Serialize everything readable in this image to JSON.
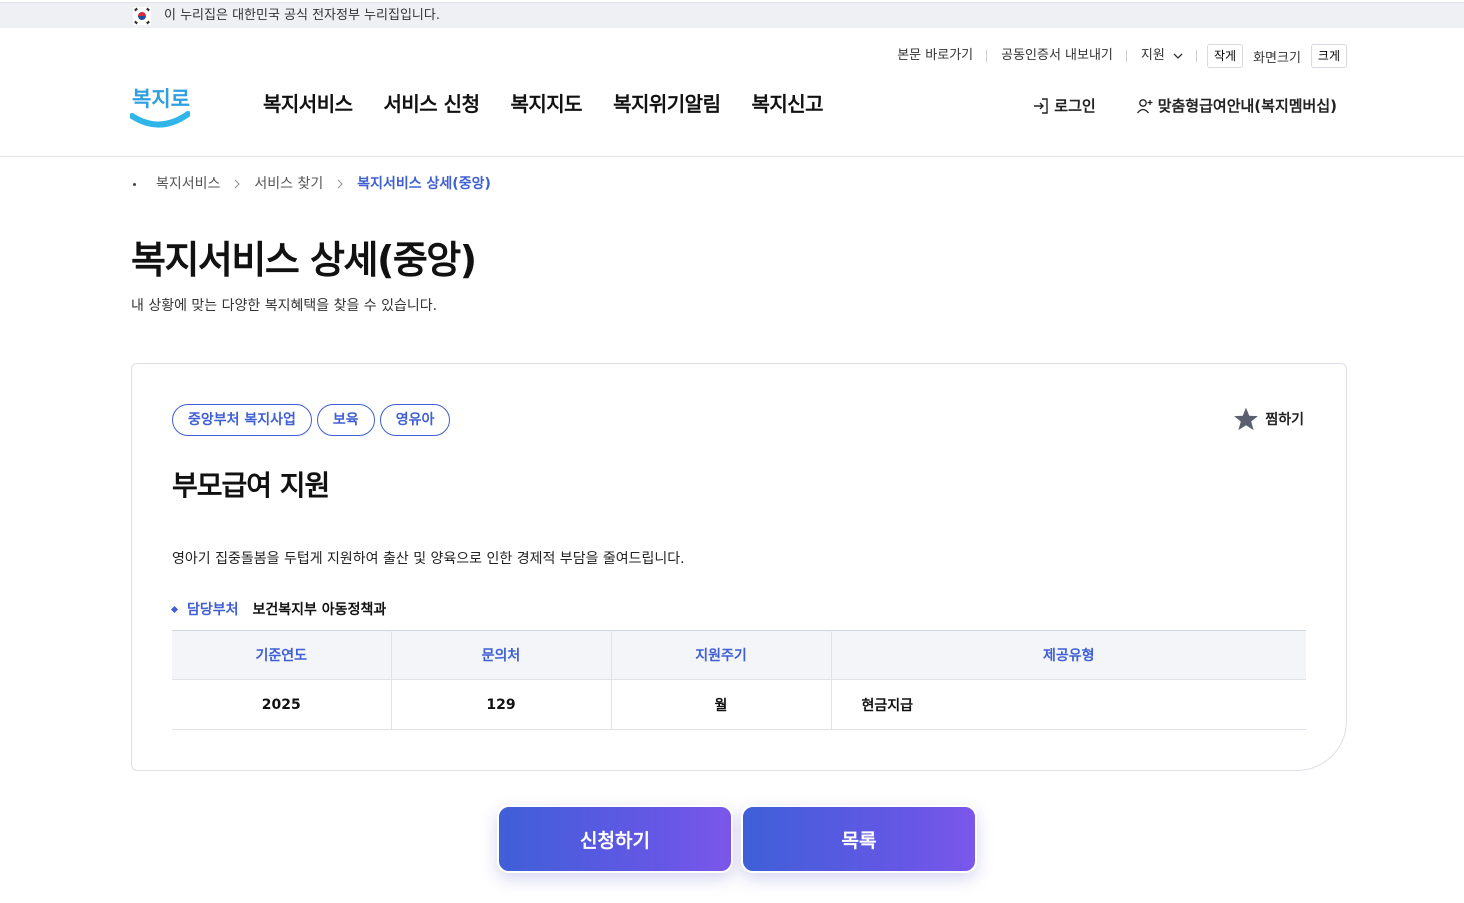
{
  "gov_banner": {
    "text": "이 누리집은 대한민국 공식 전자정부 누리집입니다."
  },
  "utility": {
    "skip": "본문 바로가기",
    "cert": "공동인증서 내보내기",
    "support": "지원",
    "small": "작게",
    "size_label": "화면크기",
    "large": "크게"
  },
  "logo": {
    "text": "복지로"
  },
  "gnb": [
    "복지서비스",
    "서비스 신청",
    "복지지도",
    "복지위기알림",
    "복지신고"
  ],
  "header_right": {
    "login": "로그인",
    "membership": "맞춤형급여안내(복지멤버십)"
  },
  "breadcrumb": [
    "복지서비스",
    "서비스 찾기",
    "복지서비스 상세(중앙)"
  ],
  "page": {
    "title": "복지서비스 상세(중앙)",
    "desc": "내 상황에 맞는 다양한 복지혜택을 찾을 수 있습니다."
  },
  "service": {
    "tags": [
      "중앙부처 복지사업",
      "보육",
      "영유아"
    ],
    "favorite": "찜하기",
    "title": "부모급여 지원",
    "desc": "영아기 집중돌봄을 두텁게 지원하여 출산 및 양육으로 인한 경제적 부담을 줄여드립니다.",
    "dept_label": "담당부처",
    "dept_value": "보건복지부 아동정책과",
    "table": {
      "headers": [
        "기준연도",
        "문의처",
        "지원주기",
        "제공유형"
      ],
      "row": [
        "2025",
        "129",
        "월",
        "현금지급"
      ]
    }
  },
  "buttons": {
    "apply": "신청하기",
    "list": "목록"
  },
  "colors": {
    "accent": "#3f5fd4",
    "button_start": "#3f5fd8",
    "button_end": "#7b57ea"
  }
}
